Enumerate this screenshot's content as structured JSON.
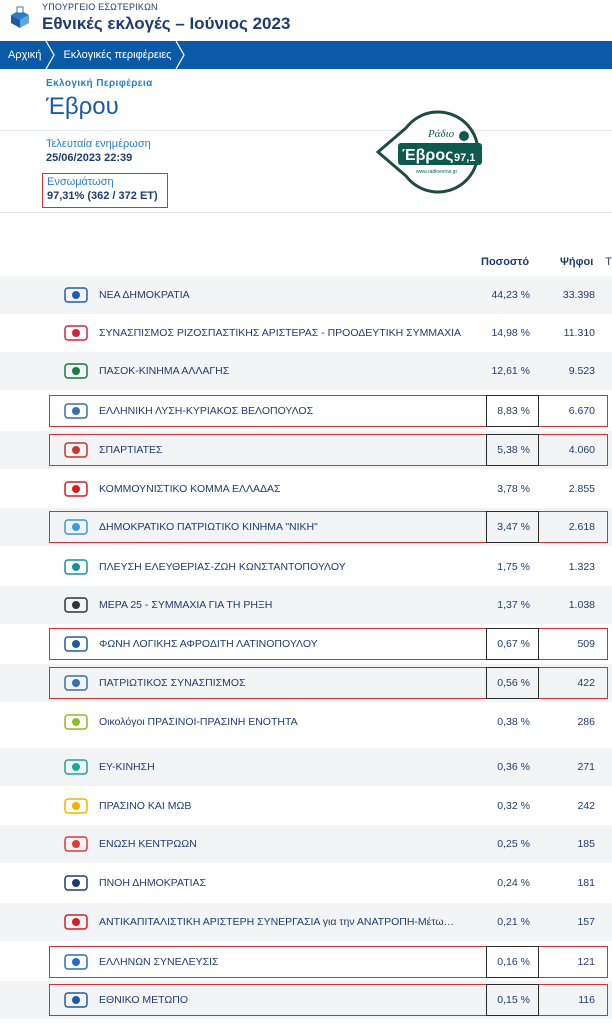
{
  "header": {
    "ministry": "ΥΠΟΥΡΓΕΙΟ ΕΣΩΤΕΡΙΚΩΝ",
    "title": "Εθνικές εκλογές – Ιούνιος 2023"
  },
  "breadcrumb": [
    "Αρχική",
    "Εκλογικές περιφέρειες"
  ],
  "region": {
    "label": "Εκλογική Περιφέρεια",
    "name": "Έβρου"
  },
  "update": {
    "label": "Τελευταία ενημέρωση",
    "value": "25/06/2023 22:39"
  },
  "integration": {
    "label": "Ενσωμάτωση",
    "value": "97,31% (362 / 372 ΕΤ)"
  },
  "watermark": {
    "small": "Ράδιο",
    "brand": "Έβρος",
    "freq": "97,1",
    "url": "www.radioevros.gr"
  },
  "table": {
    "headers": {
      "percent": "Ποσοστό",
      "votes": "Ψήφοι",
      "cut": "Τ"
    },
    "rows": [
      {
        "name": "ΝΕΑ ΔΗΜΟΚΡΑΤΙΑ",
        "percent": "44,23 %",
        "votes": "33.398",
        "icon": "nd-logo",
        "color": "#1f5fb0"
      },
      {
        "name": "ΣΥΝΑΣΠΙΣΜΟΣ ΡΙΖΟΣΠΑΣΤΙΚΗΣ ΑΡΙΣΤΕΡΑΣ - ΠΡΟΟΔΕΥΤΙΚΗ ΣΥΜΜΑΧΙΑ",
        "percent": "14,98 %",
        "votes": "11.310",
        "icon": "syriza-logo",
        "color": "#d0243f"
      },
      {
        "name": "ΠΑΣΟΚ-ΚΙΝΗΜΑ ΑΛΛΑΓΗΣ",
        "percent": "12,61 %",
        "votes": "9.523",
        "icon": "pasok-logo",
        "color": "#1b7a3d"
      },
      {
        "name": "ΕΛΛΗΝΙΚΗ ΛΥΣΗ-ΚΥΡΙΑΚΟΣ ΒΕΛΟΠΟΥΛΟΣ",
        "percent": "8,83 %",
        "votes": "6.670",
        "icon": "elliniki-lysi-logo",
        "color": "#3a6ea8"
      },
      {
        "name": "ΣΠΑΡΤΙΑΤΕΣ",
        "percent": "5,38 %",
        "votes": "4.060",
        "icon": "spartiates-logo",
        "color": "#c0392b"
      },
      {
        "name": "ΚΟΜΜΟΥΝΙΣΤΙΚΟ ΚΟΜΜΑ ΕΛΛΑΔΑΣ",
        "percent": "3,78 %",
        "votes": "2.855",
        "icon": "kke-logo",
        "color": "#d01f26"
      },
      {
        "name": "ΔΗΜΟΚΡΑΤΙΚΟ ΠΑΤΡΙΩΤΙΚΟ ΚΙΝΗΜΑ \"ΝΙΚΗ\"",
        "percent": "3,47 %",
        "votes": "2.618",
        "icon": "niki-logo",
        "color": "#3b9ad9"
      },
      {
        "name": "ΠΛΕΥΣΗ ΕΛΕΥΘΕΡΙΑΣ-ΖΩΗ ΚΩΝΣΤΑΝΤΟΠΟΥΛΟΥ",
        "percent": "1,75 %",
        "votes": "1.323",
        "icon": "plefsi-logo",
        "color": "#1a8fa0"
      },
      {
        "name": "ΜΕΡΑ 25 - ΣΥΜΜΑΧΙΑ ΓΙΑ ΤΗ ΡΗΞΗ",
        "percent": "1,37 %",
        "votes": "1.038",
        "icon": "mera25-logo",
        "color": "#333333"
      },
      {
        "name": "ΦΩΝΗ ΛΟΓΙΚΗΣ ΑΦΡΟΔΙΤΗ ΛΑΤΙΝΟΠΟΥΛΟΥ",
        "percent": "0,67 %",
        "votes": "509",
        "icon": "foni-logikis-logo",
        "color": "#1e5aa0"
      },
      {
        "name": "ΠΑΤΡΙΩΤΙΚΟΣ ΣΥΝΑΣΠΙΣΜΟΣ",
        "percent": "0,56 %",
        "votes": "422",
        "icon": "patriotikos-logo",
        "color": "#3a6ea8"
      },
      {
        "name": "Οικολόγοι ΠΡΑΣΙΝΟΙ-ΠΡΑΣΙΝΗ ΕΝΟΤΗΤΑ",
        "percent": "0,38 %",
        "votes": "286",
        "icon": "oikologoi-logo",
        "color": "#8dbb2a"
      },
      {
        "name": "ΕΥ-ΚΙΝΗΣΗ",
        "percent": "0,36 %",
        "votes": "271",
        "icon": "ev-kinisi-logo",
        "color": "#1aa5a0"
      },
      {
        "name": "ΠΡΑΣΙΝΟ ΚΑΙ ΜΩΒ",
        "percent": "0,32 %",
        "votes": "242",
        "icon": "prasino-mov-logo",
        "color": "#f0b400"
      },
      {
        "name": "ΕΝΩΣΗ ΚΕΝΤΡΩΩΝ",
        "percent": "0,25 %",
        "votes": "185",
        "icon": "enosi-kentroon-logo",
        "color": "#e03a3a"
      },
      {
        "name": "ΠΝΟΗ ΔΗΜΟΚΡΑΤΙΑΣ",
        "percent": "0,24 %",
        "votes": "181",
        "icon": "pnoi-logo",
        "color": "#1e3c6e"
      },
      {
        "name": "ΑΝΤΙΚΑΠΙΤΑΛΙΣΤΙΚΗ ΑΡΙΣΤΕΡΗ ΣΥΝΕΡΓΑΣΙΑ για την ΑΝΑΤΡΟΠΗ-Μέτω…",
        "percent": "0,21 %",
        "votes": "157",
        "icon": "antarsya-logo",
        "color": "#d01f26"
      },
      {
        "name": "ΕΛΛΗΝΩΝ ΣΥΝΕΛΕΥΣΙΣ",
        "percent": "0,16 %",
        "votes": "121",
        "icon": "ellinon-syneleusis-logo",
        "color": "#2a6db5"
      },
      {
        "name": "ΕΘΝΙΚΟ ΜΕΤΩΠΟ",
        "percent": "0,15 %",
        "votes": "116",
        "icon": "ethniko-metopo-logo",
        "color": "#1e5aa0"
      }
    ]
  }
}
